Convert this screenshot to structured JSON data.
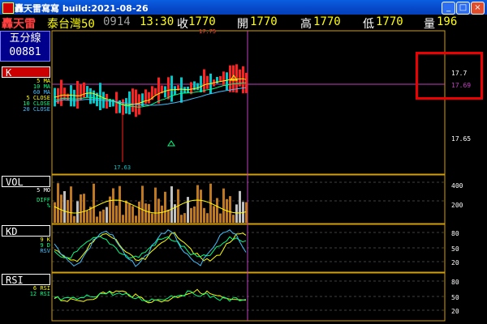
{
  "window": {
    "title": "轟天雷寫寫 build:2021-08-26",
    "min": "_",
    "max": "□",
    "close": "×"
  },
  "quote": {
    "name": "轟天雷",
    "symbol": "泰台灣50",
    "code": "0914",
    "time": "13:30",
    "close_label": "收",
    "close_value": "1770",
    "open_label": "開",
    "open_value": "1770",
    "high_label": "高",
    "high_value": "1770",
    "low_label": "低",
    "low_value": "1770",
    "vol_label": "量",
    "vol_value": "196"
  },
  "left": {
    "period": "五分線",
    "stock_code": "00881",
    "k_tag": "K",
    "k_legend": [
      "5 MA",
      "10 MA",
      "60 MA",
      "5 CLOSE",
      "10 CLOSE",
      "20 CLOSE"
    ],
    "vol_tag": "VOL",
    "vol_legend": [
      "5 MO",
      "DIFF",
      "%"
    ],
    "kd_tag": "KD",
    "kd_legend": [
      "9 K",
      "9 D",
      "RSV"
    ],
    "rsi_tag": "RSI",
    "rsi_legend": [
      "6 RSI",
      "12 RSI"
    ]
  },
  "price_axis": {
    "high": "17.7",
    "current": "17.69",
    "low": "17.65",
    "max_mark": "17.75",
    "min_mark": "17.63"
  },
  "vol_axis": [
    "400",
    "200"
  ],
  "kd_axis": [
    "80",
    "50",
    "20"
  ],
  "rsi_axis": [
    "80",
    "50",
    "20"
  ],
  "colors": {
    "up": "#ff2020",
    "down": "#00c8c8",
    "ma5": "#ffff00",
    "ma10": "#00ff80",
    "ma60": "#40c0ff",
    "crosshair": "#c040c0",
    "frame": "#d4a000",
    "vol": "#c07820",
    "highlight": "#e00000"
  }
}
